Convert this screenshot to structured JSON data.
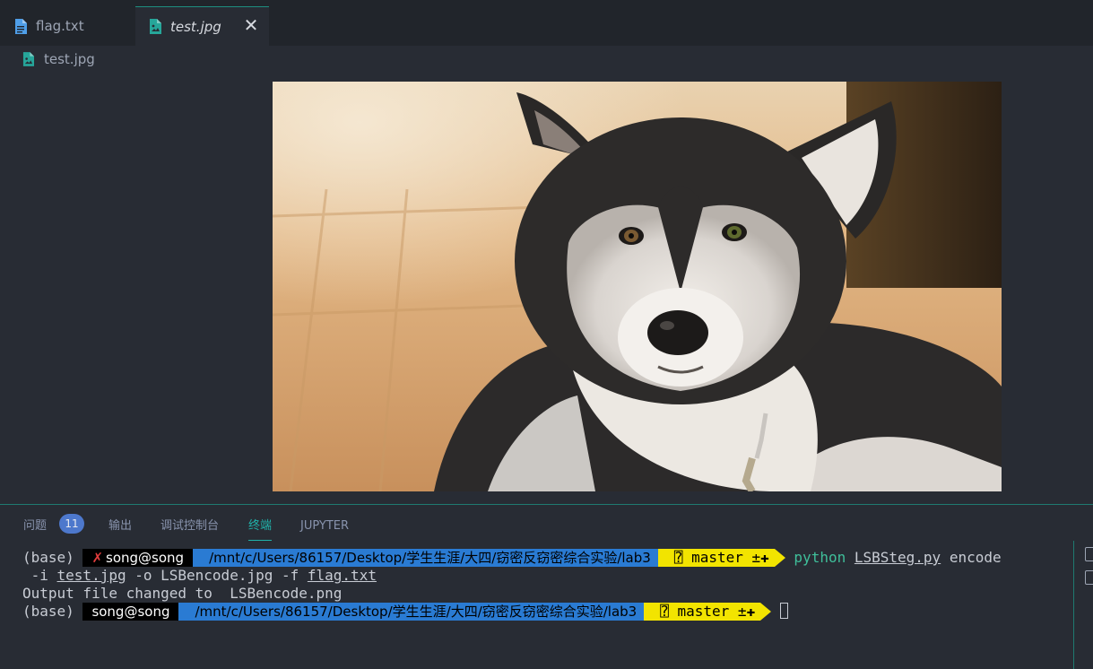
{
  "tabs": [
    {
      "label": "flag.txt",
      "icon": "file-text-icon"
    },
    {
      "label": "test.jpg",
      "icon": "image-file-icon",
      "close": "✕"
    }
  ],
  "breadcrumb": {
    "label": "test.jpg"
  },
  "panel": {
    "tabs": {
      "problems": "问题",
      "problems_count": "11",
      "output": "输出",
      "debug": "调试控制台",
      "terminal": "终端",
      "jupyter": "JUPYTER"
    }
  },
  "terminal": {
    "line1": {
      "env": "(base) ",
      "x": "✗",
      "user": "song@song",
      "path": "/mnt/c/Users/86157/Desktop/学生生涯/大四/窃密反窃密综合实验/lab3",
      "branch": "⍰ master ±✚",
      "cmd_python": "python",
      "script": "LSBSteg.py",
      "args1": " encode"
    },
    "line2": {
      "pre": " -i ",
      "input": "test.jpg",
      "mid": " -o LSBencode.jpg -f ",
      "file": "flag.txt"
    },
    "line3": {
      "text": "Output file changed to  LSBencode.png"
    },
    "line4": {
      "env": "(base) ",
      "user": "song@song",
      "path": "/mnt/c/Users/86157/Desktop/学生生涯/大四/窃密反窃密综合实验/lab3",
      "branch": "⍰ master ±✚"
    }
  },
  "colors": {
    "accent": "#20b2aa",
    "path_bg": "#2a7bd3",
    "git_bg": "#f2e400",
    "badge": "#4d78cc"
  }
}
